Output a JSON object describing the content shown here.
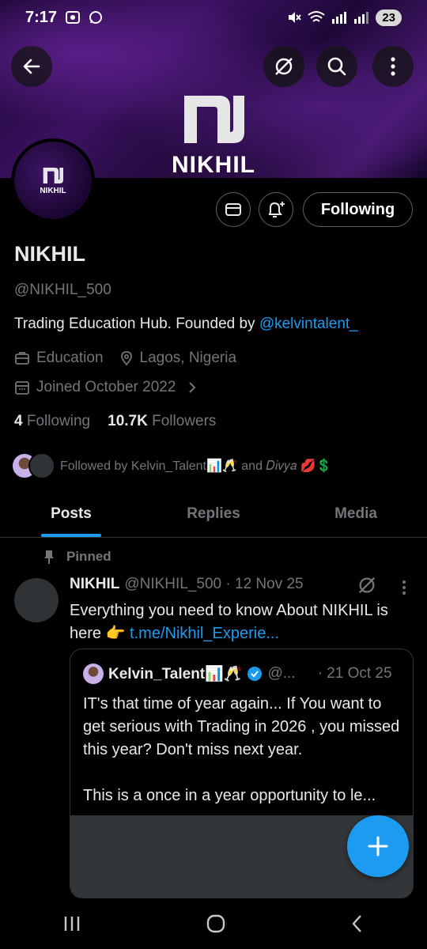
{
  "status_bar": {
    "time": "7:17",
    "battery": "23"
  },
  "banner": {
    "name": "NIKHIL"
  },
  "avatar": {
    "text": "NIKHIL"
  },
  "actions": {
    "following_label": "Following"
  },
  "profile": {
    "name": "NIKHIL",
    "handle": "@NIKHIL_500",
    "bio_text": "Trading Education Hub.  Founded by ",
    "bio_link": "@kelvintalent_",
    "category": "Education",
    "location": "Lagos, Nigeria",
    "joined": "Joined October 2022",
    "following_count": "4",
    "following_label": "Following",
    "followers_count": "10.7K",
    "followers_label": "Followers",
    "followed_by_text": "Followed by Kelvin_Talent📊🥂 and 𝐷𝑖𝑣𝑦𝑎 💋💲"
  },
  "tabs": [
    {
      "label": "Posts",
      "active": true
    },
    {
      "label": "Replies",
      "active": false
    },
    {
      "label": "Media",
      "active": false
    }
  ],
  "pinned_label": "Pinned",
  "post": {
    "author": "NIKHIL",
    "handle_date": "@NIKHIL_500 · 12 Nov 25",
    "text": "Everything you need to know About NIKHIL is here 👉 ",
    "link": "t.me/Nikhil_Experie...",
    "quote": {
      "author": "Kelvin_Talent📊🥂",
      "handle": "@...",
      "date": "· 21 Oct 25",
      "text1": "IT's that time of year again... If You want to get serious with Trading in 2026 , you missed this year? Don't miss next year.",
      "text2": "This is a once in a year opportunity to le..."
    }
  },
  "colors": {
    "accent": "#1d9bf0",
    "muted": "#71767b",
    "border": "#2f3336"
  }
}
